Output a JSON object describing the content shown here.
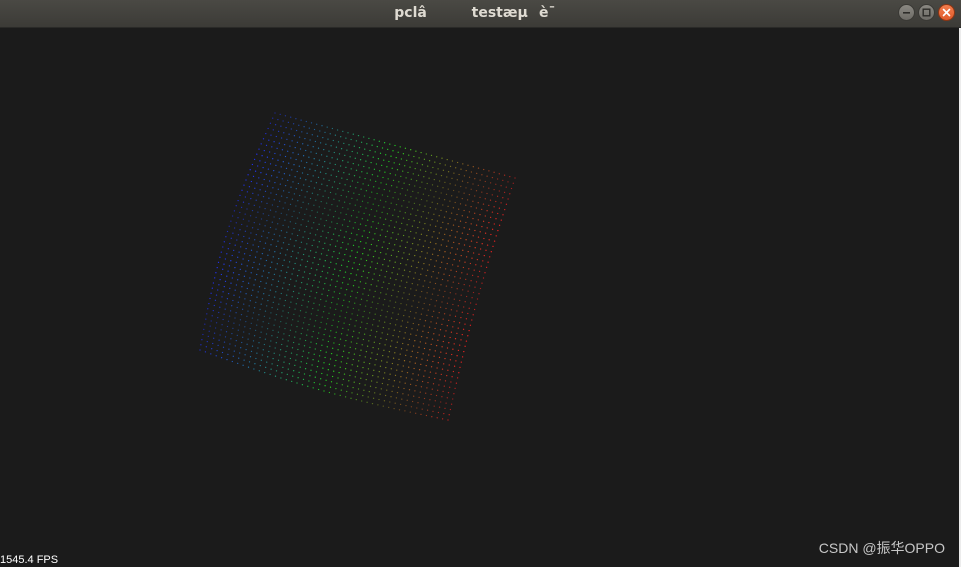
{
  "window": {
    "title": "pclâtestæµè¯"
  },
  "viewer": {
    "fps_text": "1545.4 FPS",
    "background_color": "#1b1b1b",
    "point_cloud": {
      "type": "scatter",
      "color_gradient": [
        "#2233ff",
        "#22dd22",
        "#ff2222"
      ]
    }
  },
  "watermark": {
    "text": "CSDN @振华OPPO"
  },
  "icons": {
    "minimize": "minimize-icon",
    "maximize": "maximize-icon",
    "close": "close-icon"
  }
}
